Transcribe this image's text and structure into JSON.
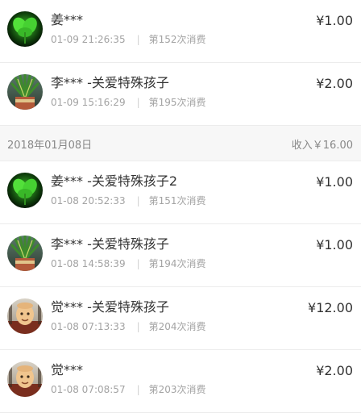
{
  "transactions_top": [
    {
      "name": "姜***",
      "time": "01-09 21:26:35",
      "count": "第152次消费",
      "amount": "¥1.00",
      "avatar": "green-leaf-avatar"
    },
    {
      "name": "李*** -关爱特殊孩子",
      "time": "01-09 15:16:29",
      "count": "第195次消费",
      "amount": "¥2.00",
      "avatar": "plant-pot-avatar"
    }
  ],
  "day_group": {
    "date": "2018年01月08日",
    "income": "收入￥16.00"
  },
  "transactions_day": [
    {
      "name": "姜*** -关爱特殊孩子2",
      "time": "01-08 20:52:33",
      "count": "第151次消费",
      "amount": "¥1.00",
      "avatar": "green-leaf-avatar"
    },
    {
      "name": "李*** -关爱特殊孩子",
      "time": "01-08 14:58:39",
      "count": "第194次消费",
      "amount": "¥1.00",
      "avatar": "plant-pot-avatar"
    },
    {
      "name": "觉*** -关爱特殊孩子",
      "time": "01-08 07:13:33",
      "count": "第204次消费",
      "amount": "¥12.00",
      "avatar": "monk-avatar"
    },
    {
      "name": "觉***",
      "time": "01-08 07:08:57",
      "count": "第203次消费",
      "amount": "¥2.00",
      "avatar": "monk-avatar"
    }
  ]
}
